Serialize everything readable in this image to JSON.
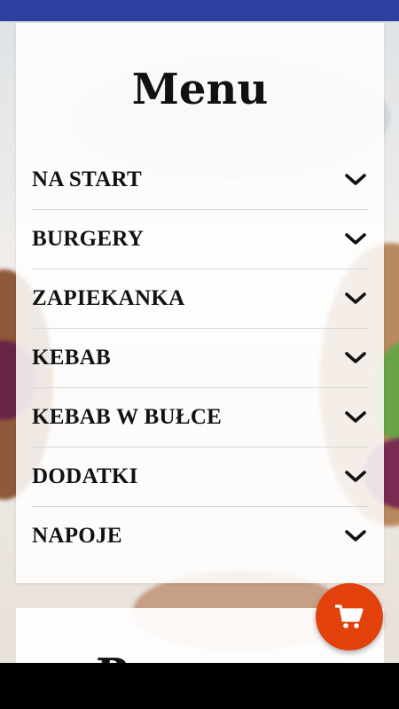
{
  "menu": {
    "title": "Menu",
    "items": [
      {
        "label": "NA START"
      },
      {
        "label": "BURGERY"
      },
      {
        "label": "ZAPIEKANKA"
      },
      {
        "label": "KEBAB"
      },
      {
        "label": "KEBAB W BUŁCE"
      },
      {
        "label": "DODATKI"
      },
      {
        "label": "NAPOJE"
      }
    ]
  },
  "second_card": {
    "title_partial": "Pr"
  },
  "icons": {
    "chevron": "chevron-down-icon",
    "cart": "shopping-cart-icon"
  },
  "colors": {
    "status_bar": "#2f3fa0",
    "cart_button": "#e2410c",
    "nav_bar": "#000000"
  }
}
